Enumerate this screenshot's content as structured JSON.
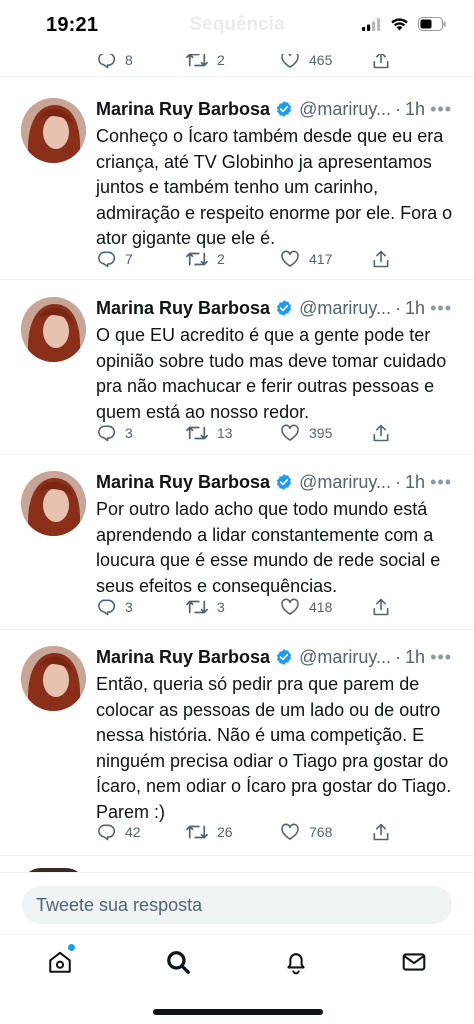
{
  "status_bar": {
    "time": "19:21",
    "title": "Sequência"
  },
  "previous_tweet": {
    "replies": "8",
    "retweets": "2",
    "likes": "465"
  },
  "tweets": [
    {
      "name": "Marina Ruy Barbosa",
      "handle": "@mariruy...",
      "time": "1h",
      "text": "Conheço o Ícaro também desde que eu era criança, até TV Globinho ja apresentamos juntos e também tenho um carinho, admiração e respeito enorme por ele. Fora o ator gigante que ele é.",
      "replies": "7",
      "retweets": "2",
      "likes": "417"
    },
    {
      "name": "Marina Ruy Barbosa",
      "handle": "@mariruy...",
      "time": "1h",
      "text": "O que EU acredito é que a gente pode ter opinião sobre tudo mas deve tomar cuidado pra não machucar e ferir outras pessoas e quem está ao nosso redor.",
      "replies": "3",
      "retweets": "13",
      "likes": "395"
    },
    {
      "name": "Marina Ruy Barbosa",
      "handle": "@mariruy...",
      "time": "1h",
      "text": "Por outro lado acho que todo mundo está aprendendo a lidar constantemente com a loucura que é esse mundo de rede social e seus efeitos e consequências.",
      "replies": "3",
      "retweets": "3",
      "likes": "418"
    },
    {
      "name": "Marina Ruy Barbosa",
      "handle": "@mariruy...",
      "time": "1h",
      "text": "Então, queria só pedir pra que parem de colocar as pessoas de um lado ou de outro nessa história. Não é uma competição. E ninguém precisa odiar o Tiago pra gostar do Ícaro, nem odiar o Ícaro pra gostar do Tiago. Parem :)",
      "replies": "42",
      "retweets": "26",
      "likes": "768"
    }
  ],
  "reply": {
    "placeholder": "Tweete sua resposta"
  },
  "nav": {
    "items": [
      "home-icon",
      "search-icon",
      "bell-icon",
      "mail-icon"
    ]
  },
  "colors": {
    "accent": "#1d9bf0",
    "text": "#0f1419",
    "secondary": "#536471"
  }
}
